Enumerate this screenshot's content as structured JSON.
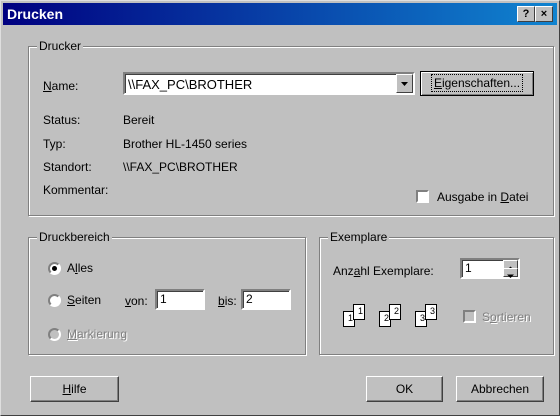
{
  "window": {
    "title": "Drucken",
    "help_btn": "?",
    "close_btn": "×"
  },
  "printer": {
    "group_label": "Drucker",
    "name_label": "Name:",
    "name_value": "\\\\FAX_PC\\BROTHER",
    "properties_btn": "Eigenschaften...",
    "status_label": "Status:",
    "status_value": "Bereit",
    "type_label": "Typ:",
    "type_value": "Brother HL-1450 series",
    "location_label": "Standort:",
    "location_value": "\\\\FAX_PC\\BROTHER",
    "comment_label": "Kommentar:",
    "comment_value": "",
    "print_to_file_label": "Ausgabe in Datei",
    "print_to_file_checked": false
  },
  "range": {
    "group_label": "Druckbereich",
    "all_label": "Alles",
    "pages_label": "Seiten",
    "from_label": "von:",
    "from_value": "1",
    "to_label": "bis:",
    "to_value": "2",
    "selection_label": "Markierung",
    "selected": "all"
  },
  "copies": {
    "group_label": "Exemplare",
    "count_label": "Anzahl Exemplare:",
    "count_value": "1",
    "collate_label": "Sortieren",
    "collate_checked": false,
    "collate_enabled": false,
    "page_numbers": [
      "1",
      "1",
      "2",
      "2",
      "3",
      "3"
    ]
  },
  "buttons": {
    "help": "Hilfe",
    "ok": "OK",
    "cancel": "Abbrechen"
  }
}
